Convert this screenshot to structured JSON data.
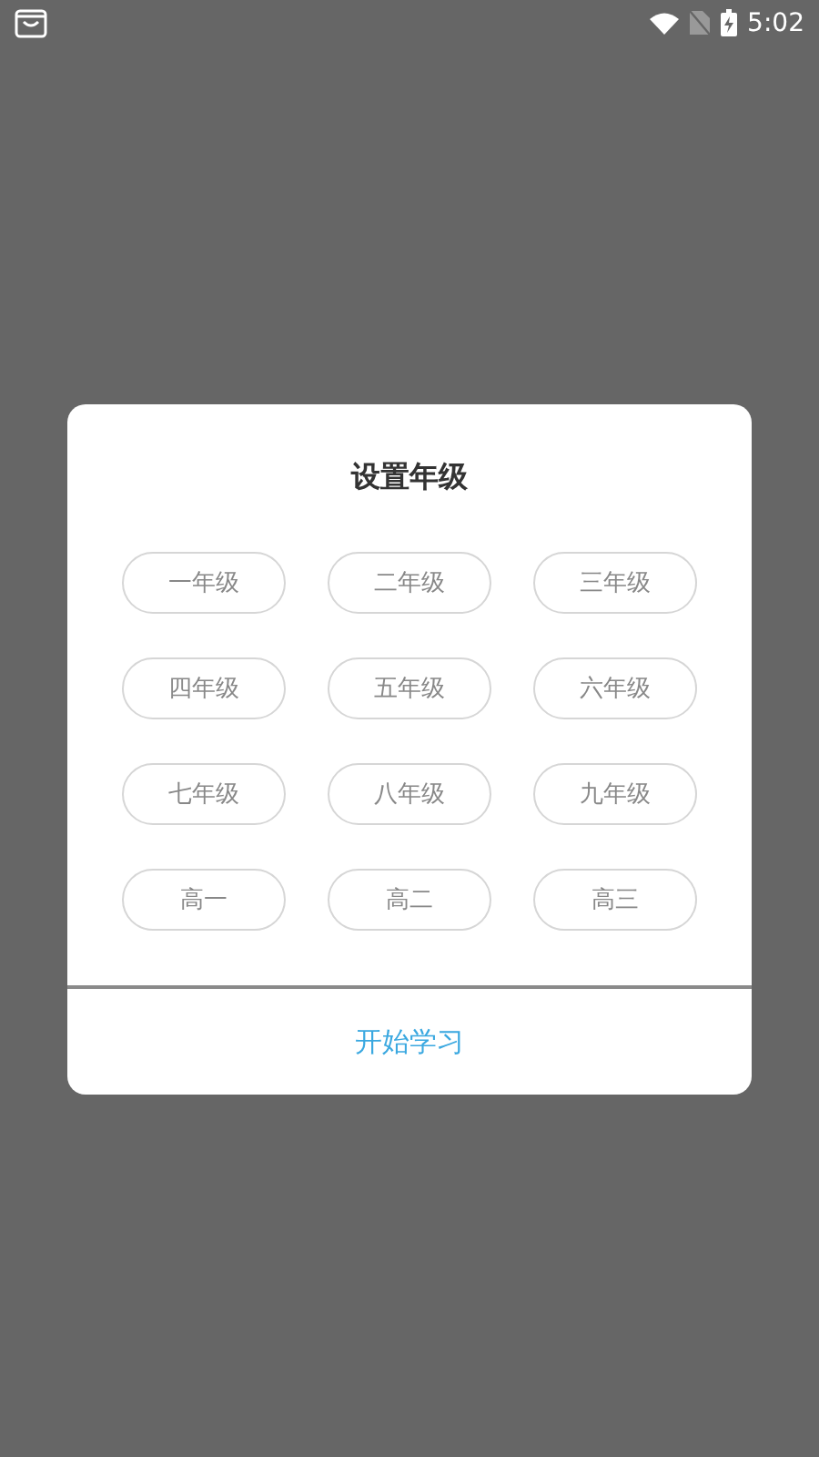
{
  "status_bar": {
    "time": "5:02"
  },
  "dialog": {
    "title": "设置年级",
    "grades": [
      {
        "label": "一年级",
        "selected": false
      },
      {
        "label": "二年级",
        "selected": false
      },
      {
        "label": "三年级",
        "selected": false
      },
      {
        "label": "四年级",
        "selected": false
      },
      {
        "label": "五年级",
        "selected": false
      },
      {
        "label": "六年级",
        "selected": false
      },
      {
        "label": "七年级",
        "selected": false
      },
      {
        "label": "八年级",
        "selected": false
      },
      {
        "label": "九年级",
        "selected": false
      },
      {
        "label": "高一",
        "selected": false
      },
      {
        "label": "高二",
        "selected": false
      },
      {
        "label": "高三",
        "selected": false
      }
    ],
    "action": "开始学习"
  }
}
